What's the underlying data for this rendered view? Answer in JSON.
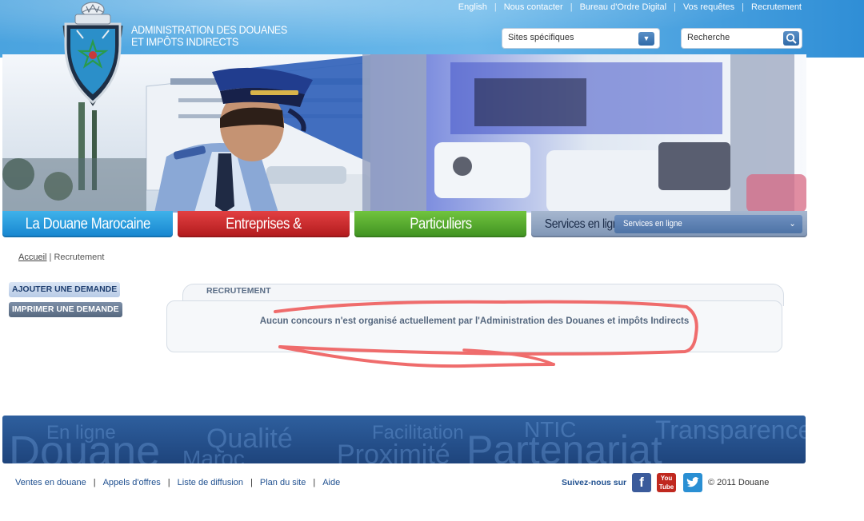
{
  "header": {
    "org_line1": "Administration des Douanes",
    "org_line2": "et Impôts Indirects",
    "top_links": [
      "English",
      "Nous contacter",
      "Bureau d'Ordre Digital",
      "Vos requêtes",
      "Recrutement"
    ],
    "sites_select": "Sites spécifiques",
    "search_placeholder": "Recherche"
  },
  "tabs": {
    "douane": "La Douane Marocaine",
    "entreprises": "Entreprises & Professionnels",
    "particuliers": "Particuliers",
    "services_label": "Services en ligne",
    "services_select": "Services en ligne"
  },
  "breadcrumb": {
    "home": "Accueil",
    "separator": "|",
    "current": "Recrutement"
  },
  "sidebar": {
    "add": "Ajouter une demande",
    "print": "Imprimer une demande"
  },
  "content": {
    "title": "RECRUTEMENT",
    "message": "Aucun concours n'est organisé actuellement par l'Administration des Douanes et impôts Indirects"
  },
  "band_words": [
    "En ligne",
    "Douane",
    "Qualité",
    "Maroc",
    "Facilitation",
    "Proximité",
    "NTIC",
    "Partenariat",
    "Transparence"
  ],
  "footer": {
    "links": [
      "Ventes en douane",
      "Appels d'offres",
      "Liste de diffusion",
      "Plan du site",
      "Aide"
    ],
    "follow": "Suivez-nous sur",
    "facebook": "f",
    "youtube_1": "You",
    "youtube_2": "Tube",
    "copyright": "© 2011 Douane"
  },
  "colors": {
    "header_blue": "#4aa3df",
    "tab_douane": "#1685cf",
    "tab_entreprises": "#b11a1c",
    "tab_particuliers": "#3f9121",
    "tab_services": "#7f95b5",
    "annotation_red": "#ef6c6c"
  }
}
